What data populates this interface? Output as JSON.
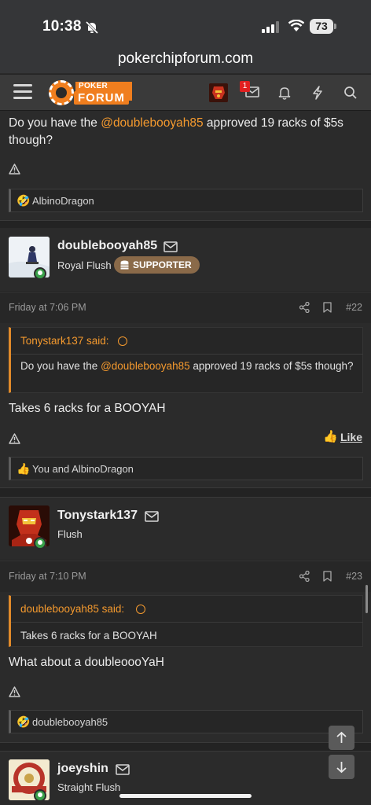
{
  "status": {
    "time": "10:38",
    "battery": "73"
  },
  "browser": {
    "url": "pokerchipforum.com"
  },
  "header": {
    "logo_top": "POKER CHIP",
    "logo_bottom": "FORUM",
    "inbox_badge": "1"
  },
  "post21_tail": {
    "text_before": "Do you have the ",
    "mention": "@doublebooyah85",
    "text_after": " approved 19 racks of $5s though?",
    "reactions": "AlbinoDragon"
  },
  "post22": {
    "username": "doublebooyah85",
    "rank": "Royal Flush",
    "badge": "SUPPORTER",
    "date": "Friday at 7:06 PM",
    "number": "#22",
    "quote_author": "Tonystark137 said:",
    "quote_before": "Do you have the ",
    "quote_mention": "@doublebooyah85",
    "quote_after": " approved 19 racks of $5s though?",
    "text": "Takes 6 racks for a BOOYAH",
    "like_label": "Like",
    "reactions": "You and AlbinoDragon"
  },
  "post23": {
    "username": "Tonystark137",
    "rank": "Flush",
    "date": "Friday at 7:10 PM",
    "number": "#23",
    "quote_author": "doublebooyah85 said:",
    "quote_text": "Takes 6 racks for a BOOYAH",
    "text": "What about a doubleoooYaH",
    "reactions": "doublebooyah85"
  },
  "post24": {
    "username": "joeyshin",
    "rank": "Straight Flush"
  },
  "icons": {
    "accent": "#f59a2e",
    "online": "#3aa14a",
    "supporter_bg": "#8a6a49"
  }
}
